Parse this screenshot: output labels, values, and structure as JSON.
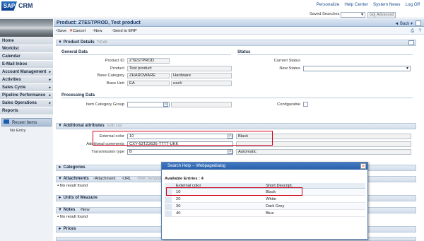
{
  "header": {
    "logo_text": "SAP",
    "app_name": "CRM",
    "links": [
      "Personalize",
      "Help Center",
      "System News",
      "Log Off"
    ],
    "saved_searches_label": "Saved Searches",
    "go_label": "Go",
    "advanced_label": "Advanced"
  },
  "sidebar": {
    "items": [
      {
        "label": "Home",
        "has_arrow": false
      },
      {
        "label": "Worklist",
        "has_arrow": false
      },
      {
        "label": "Calendar",
        "has_arrow": false
      },
      {
        "label": "E-Mail Inbox",
        "has_arrow": false
      },
      {
        "label": "Account Management",
        "has_arrow": true
      },
      {
        "label": "Activities",
        "has_arrow": true
      },
      {
        "label": "Sales Cycle",
        "has_arrow": true
      },
      {
        "label": "Pipeline Performance",
        "has_arrow": true
      },
      {
        "label": "Sales Operations",
        "has_arrow": true
      },
      {
        "label": "Reports",
        "has_arrow": false
      }
    ],
    "recent_items_label": "Recent Items",
    "no_entry_label": "No Entry"
  },
  "page": {
    "title": "Product: ZTESTPROD, Test product",
    "back_label": "Back",
    "toolbar": {
      "save": "Save",
      "cancel": "Cancel",
      "new": "New",
      "send_to_erp": "Send to ERP"
    }
  },
  "product_details": {
    "section_title": "Product Details",
    "edit_label": "Edit",
    "general_data_title": "General Data",
    "status_title": "Status",
    "fields": {
      "product_id_label": "Product ID",
      "product_id_value": "ZTESTPROD",
      "product_label": "Product",
      "product_value": "Test product",
      "base_category_label": "Base Category",
      "base_category_value": "ZHARDWARE",
      "base_category_desc": "Hardware",
      "base_unit_label": "Base Unit",
      "base_unit_value": "EA",
      "base_unit_desc": "each",
      "current_status_label": "Current Status",
      "new_status_label": "New Status"
    },
    "processing_data_title": "Processing Data",
    "item_category_group_label": "Item Category Group",
    "configurable_label": "Configurable"
  },
  "additional_attributes": {
    "section_title": "Additional attributes",
    "edit_list_label": "Edit List",
    "external_color_label": "External color",
    "external_color_value": "10",
    "external_color_desc": "Black",
    "additional_comments_label": "Additional comments",
    "additional_comments_value": "CXY-63TZ3636-TTTT-UKK",
    "transmission_type_label": "Transmission type",
    "transmission_type_value": "B",
    "transmission_type_desc": "Automatic"
  },
  "collapsed_sections": {
    "categories": "Categories",
    "attachments": "Attachments",
    "attachment_btn": "Attachment",
    "url_btn": "URL",
    "with_template_btn": "With Template",
    "no_result": "No result found",
    "units_of_measure": "Units of Measure",
    "notes": "Notes",
    "notes_new": "New",
    "prices": "Prices"
  },
  "dialog": {
    "title": "Search Help -- Webpagedialog",
    "available_entries_label": "Available Entries : 4",
    "col_external_color": "External color",
    "col_short_descript": "Short Descript.",
    "rows": [
      {
        "code": "10",
        "desc": "Black"
      },
      {
        "code": "20",
        "desc": "White"
      },
      {
        "code": "30",
        "desc": "Dark Grey"
      },
      {
        "code": "40",
        "desc": "Blue"
      }
    ]
  },
  "colors": {
    "accent": "#2a5fa8",
    "highlight": "#d0021b",
    "sidebar_bg": "#eef1f5"
  }
}
